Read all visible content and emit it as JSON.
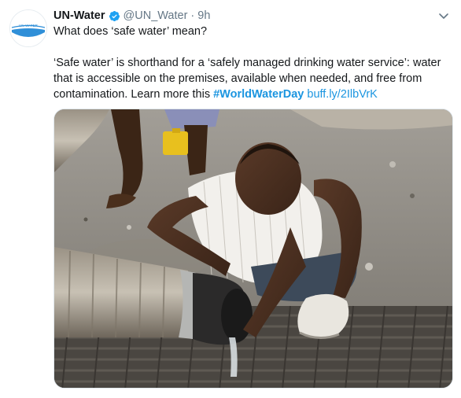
{
  "tweet": {
    "display_name": "UN-Water",
    "handle": "@UN_Water",
    "separator": "·",
    "time": "9h",
    "paragraph1": "What does ‘safe water’ mean?",
    "paragraph2_text": "‘Safe water’ is shorthand for a ‘safely managed drinking water service’: water that is accessible on the premises, available when needed, and free from contamination. Learn more this ",
    "hashtag": "#WorldWaterDay",
    "link": "buff.ly/2IlbVrK",
    "avatar_logo_text": "UN-WATER"
  },
  "colors": {
    "accent": "#1b95e0",
    "verified": "#1da1f2",
    "secondary_text": "#657786",
    "logo_blue": "#2f8fd8"
  },
  "icons": {
    "verified": "verified-badge-icon",
    "caret": "chevron-down-icon"
  }
}
